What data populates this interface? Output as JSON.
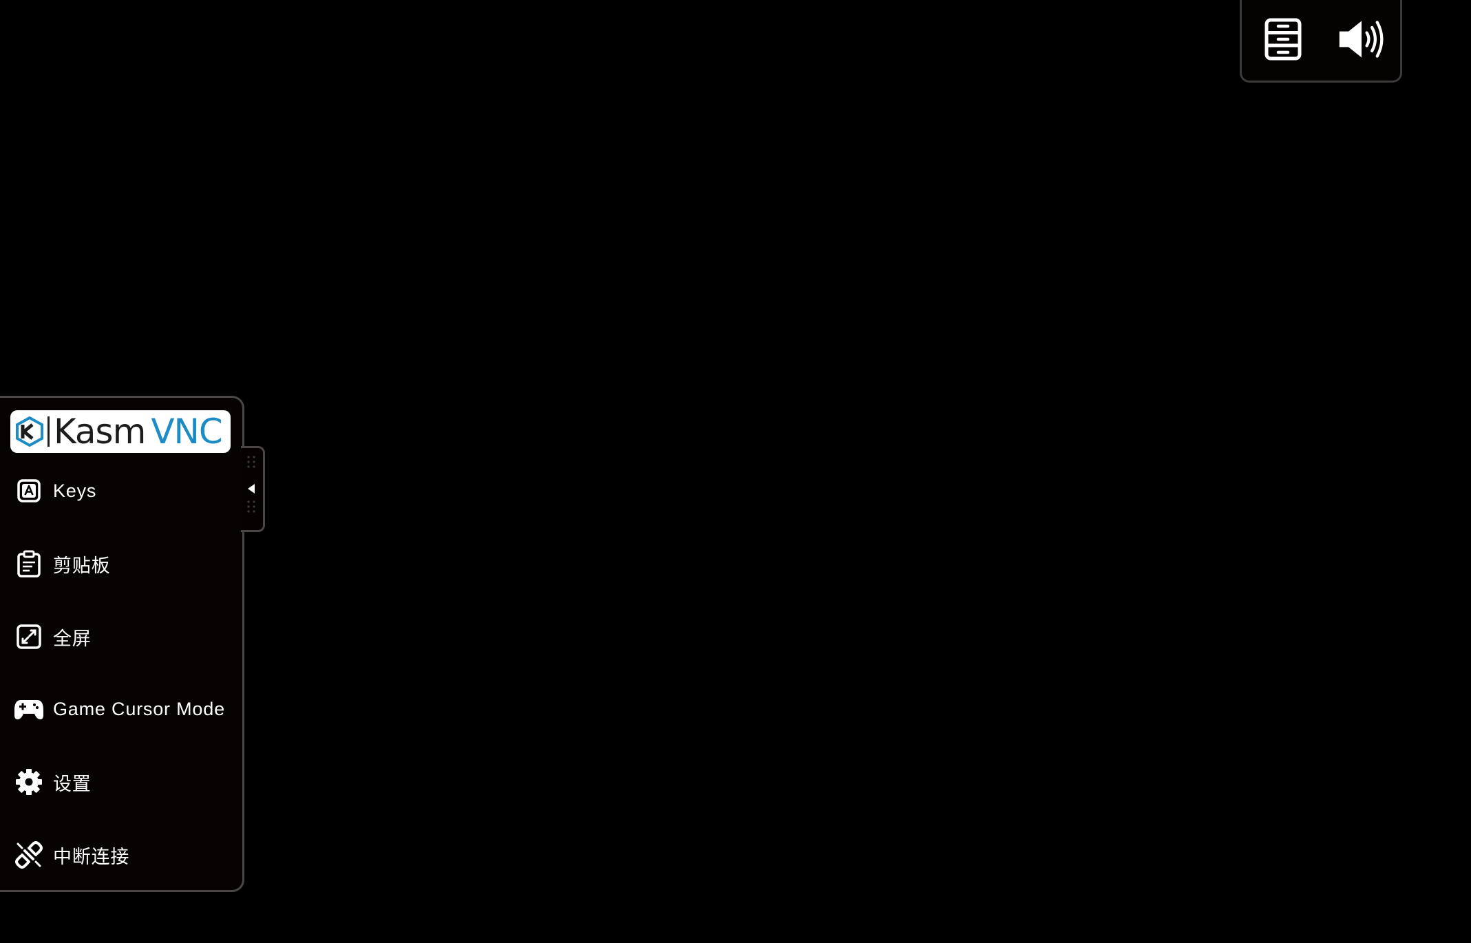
{
  "top_panel": {
    "buttons": [
      {
        "icon": "server-drawer-icon"
      },
      {
        "icon": "speaker-volume-icon"
      }
    ]
  },
  "control_bar": {
    "logo": {
      "word_dark": "Kasm",
      "word_accent": "VNC",
      "accent_color": "#1d8cc6"
    },
    "items": [
      {
        "label": "Keys",
        "icon": "keyboard-key-a-icon"
      },
      {
        "label": "剪贴板",
        "icon": "clipboard-icon"
      },
      {
        "label": "全屏",
        "icon": "fullscreen-expand-icon"
      },
      {
        "label": "Game Cursor Mode",
        "icon": "gamepad-icon"
      },
      {
        "label": "设置",
        "icon": "gear-icon"
      },
      {
        "label": "中断连接",
        "icon": "disconnect-plug-icon"
      }
    ]
  },
  "handle": {
    "icon": "collapse-arrow-left-icon"
  }
}
